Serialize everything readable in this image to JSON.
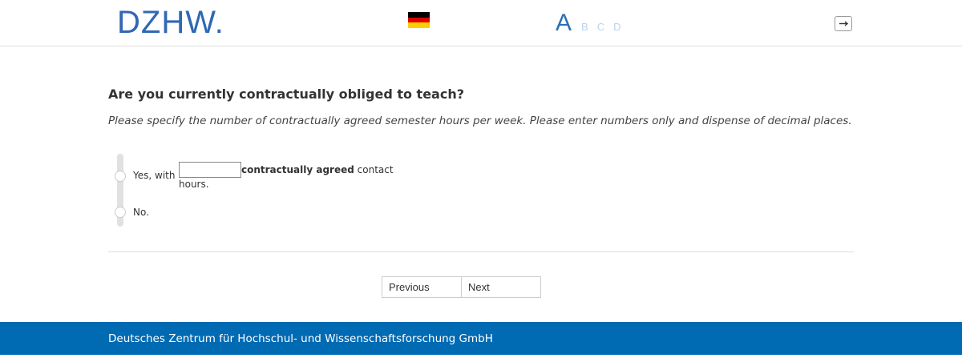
{
  "header": {
    "logo_text": "DZHW.",
    "flag_icon": "german-flag-icon",
    "flag_colors": [
      "#000000",
      "#dd0000",
      "#ffce00"
    ],
    "steps": [
      {
        "label": "A",
        "active": true
      },
      {
        "label": "B",
        "active": false
      },
      {
        "label": "C",
        "active": false
      },
      {
        "label": "D",
        "active": false
      }
    ],
    "exit_icon": "exit-icon"
  },
  "question": {
    "title": "Are you currently contractually obliged to teach?",
    "instruction": "Please specify the number of contractually agreed semester hours per week. Please enter numbers only and dispense of decimal places."
  },
  "options": {
    "yes_prefix": "Yes, with",
    "yes_input_value": "",
    "yes_suffix_bold": "contractually agreed",
    "yes_suffix_rest": " contact",
    "yes_suffix_line2": "hours.",
    "no_label": "No."
  },
  "navigation": {
    "previous_label": "Previous",
    "next_label": "Next"
  },
  "footer": {
    "text": "Deutsches Zentrum für Hochschul- und Wissenschaftsforschung GmbH"
  },
  "colors": {
    "brand_blue": "#006ab3",
    "logo_blue": "#2f68b4",
    "step_inactive": "#b7d4ee"
  }
}
